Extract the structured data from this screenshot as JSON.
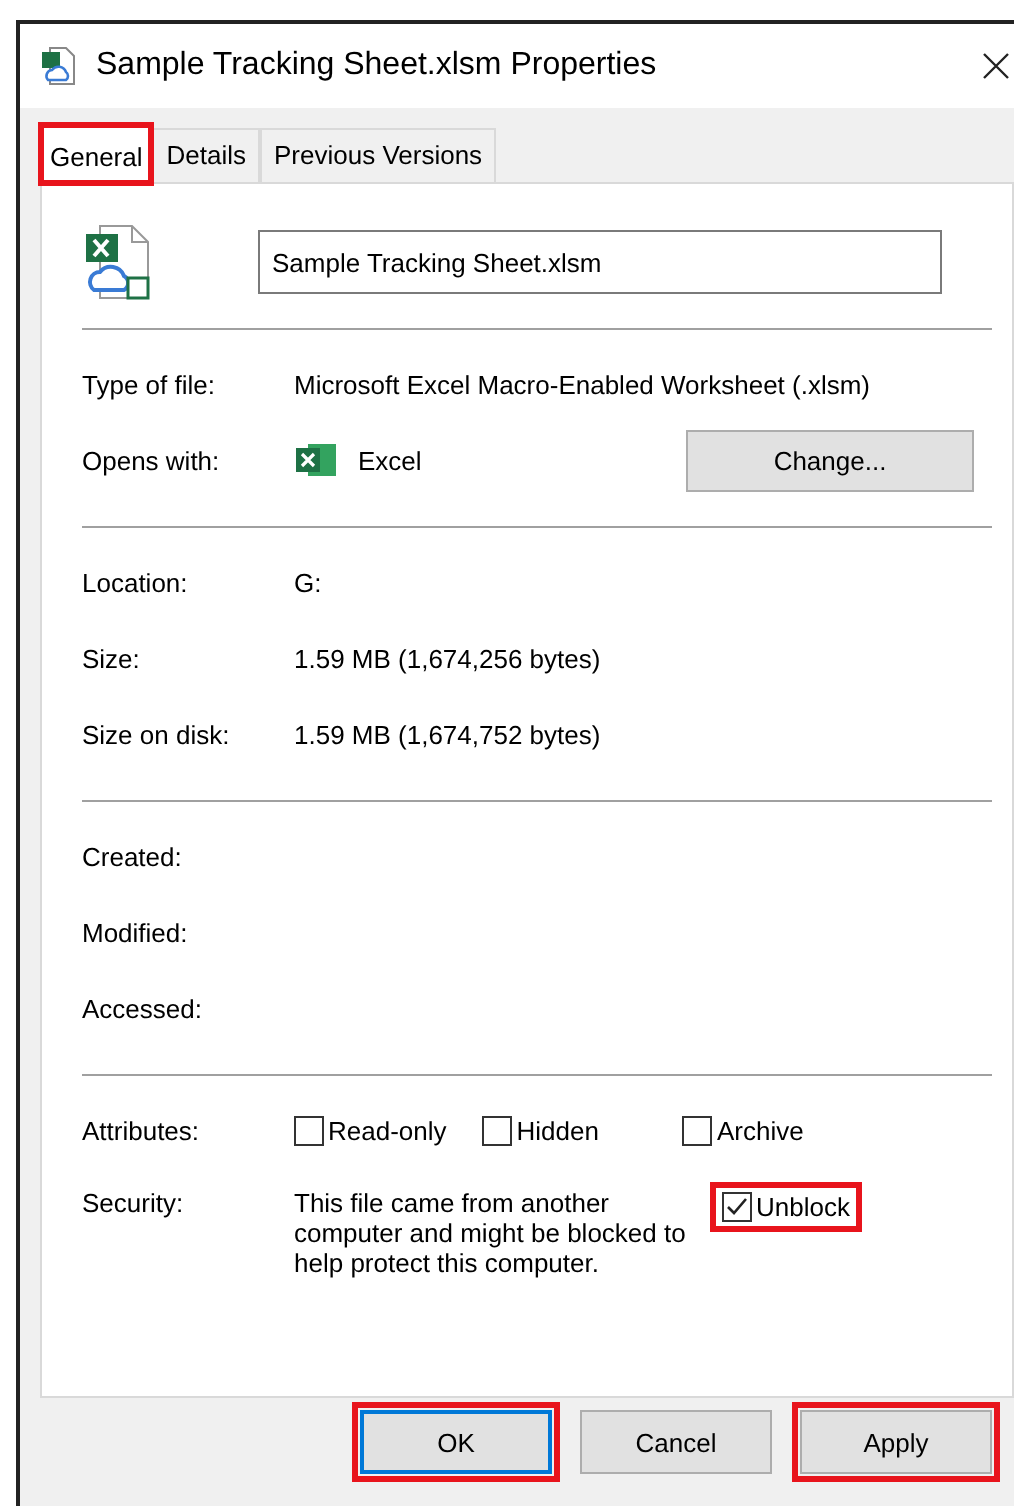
{
  "window": {
    "title": "Sample Tracking Sheet.xlsm Properties"
  },
  "tabs": [
    {
      "label": "General",
      "selected": true,
      "highlighted": true
    },
    {
      "label": "Details",
      "selected": false,
      "highlighted": false
    },
    {
      "label": "Previous Versions",
      "selected": false,
      "highlighted": false
    }
  ],
  "file_name": {
    "value": "Sample Tracking Sheet.xlsm"
  },
  "sections": [
    [
      {
        "kind": "text",
        "label": "Type of file:",
        "value": "Microsoft Excel Macro-Enabled Worksheet (.xlsm)"
      },
      {
        "kind": "app",
        "label": "Opens with:",
        "value": "Excel",
        "button": "Change..."
      }
    ],
    [
      {
        "kind": "text",
        "label": "Location:",
        "value": "G:"
      },
      {
        "kind": "text",
        "label": "Size:",
        "value": "1.59 MB (1,674,256 bytes)"
      },
      {
        "kind": "text",
        "label": "Size on disk:",
        "value": "1.59 MB (1,674,752 bytes)"
      }
    ],
    [
      {
        "kind": "text",
        "label": "Created:"
      },
      {
        "kind": "text",
        "label": "Modified:"
      },
      {
        "kind": "text",
        "label": "Accessed:"
      }
    ]
  ],
  "attributes": {
    "label": "Attributes:",
    "options": [
      {
        "label": "Read-only",
        "checked": false
      },
      {
        "label": "Hidden",
        "checked": false
      },
      {
        "label": "Archive",
        "checked": false
      }
    ]
  },
  "security": {
    "label": "Security:",
    "text": "This file came from another computer and might be blocked to help protect this computer.",
    "unblock": {
      "label": "Unblock",
      "checked": true,
      "highlighted": true
    }
  },
  "buttons": [
    {
      "label": "OK",
      "default": true,
      "highlighted": true
    },
    {
      "label": "Cancel",
      "default": false,
      "highlighted": false
    },
    {
      "label": "Apply",
      "default": false,
      "highlighted": true
    }
  ]
}
